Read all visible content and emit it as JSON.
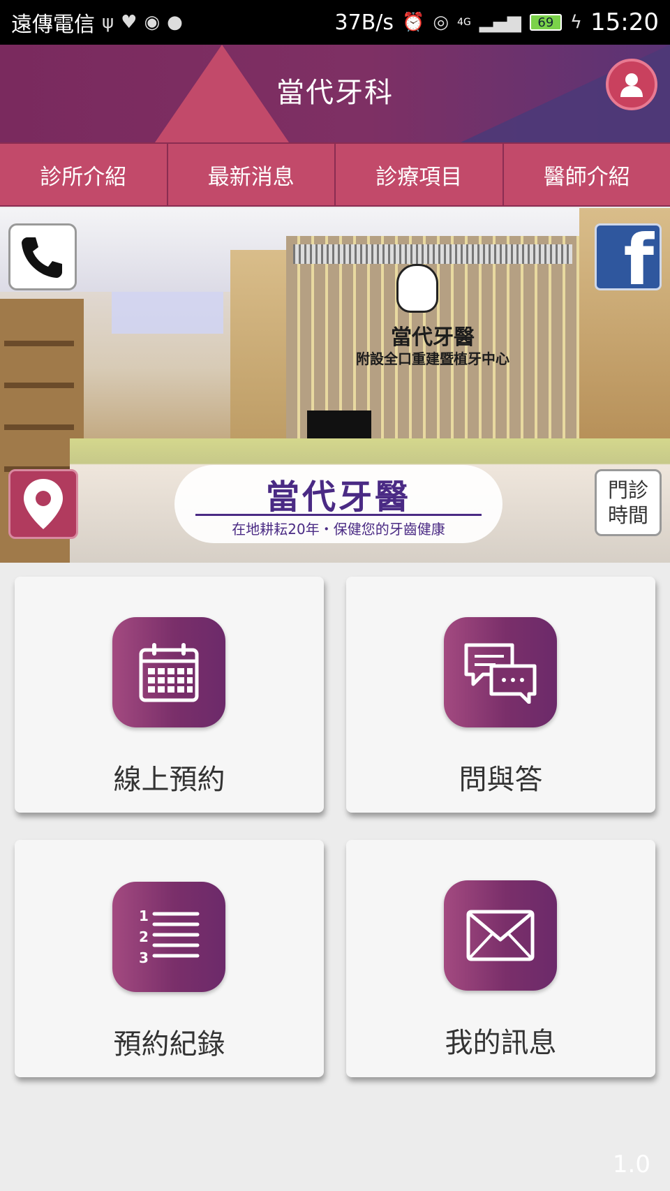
{
  "status_bar": {
    "carrier": "遠傳電信",
    "speed": "37B/s",
    "network": "4G",
    "battery": "69",
    "time": "15:20"
  },
  "header": {
    "title": "當代牙科"
  },
  "nav": {
    "items": [
      {
        "label": "診所介紹"
      },
      {
        "label": "最新消息"
      },
      {
        "label": "診療項目"
      },
      {
        "label": "醫師介紹"
      }
    ]
  },
  "banner": {
    "wall_sign": "當代牙醫",
    "wall_sign_sub": "附設全口重建暨植牙中心",
    "sign_title": "當代牙醫",
    "sign_subtitle": "在地耕耘20年・保健您的牙齒健康",
    "hours_line1": "門診",
    "hours_line2": "時間",
    "fb_letter": "f"
  },
  "tiles": [
    {
      "label": "線上預約",
      "icon": "calendar-icon"
    },
    {
      "label": "問與答",
      "icon": "chat-bubbles-icon"
    },
    {
      "label": "預約紀錄",
      "icon": "numbered-list-icon"
    },
    {
      "label": "我的訊息",
      "icon": "envelope-icon"
    }
  ],
  "version": "1.0",
  "colors": {
    "brand_purple": "#7a2f6a",
    "brand_rose": "#c24a6a",
    "facebook_blue": "#2f579e"
  }
}
